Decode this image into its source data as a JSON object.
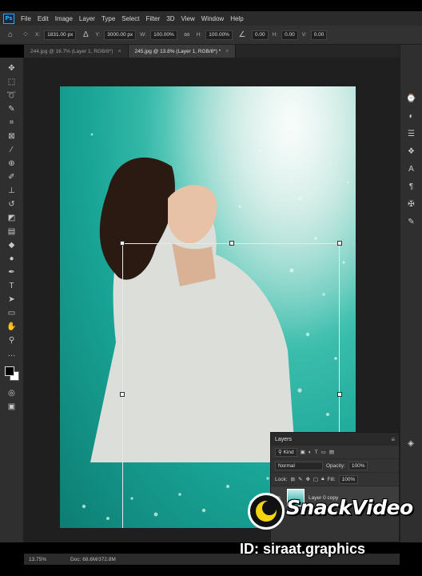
{
  "app": {
    "logo_text": "Ps"
  },
  "menubar": [
    "File",
    "Edit",
    "Image",
    "Layer",
    "Type",
    "Select",
    "Filter",
    "3D",
    "View",
    "Window",
    "Help"
  ],
  "options": {
    "x_label": "X:",
    "x_value": "1831.00 px",
    "y_label": "Y:",
    "y_value": "3000.00 px",
    "w_label": "W:",
    "w_value": "100.00%",
    "h_label": "H:",
    "h_value": "100.00%",
    "angle_value": "0.00",
    "h_skew_label": "H:",
    "h_skew_value": "0.00",
    "v_skew_label": "V:",
    "v_skew_value": "0.00"
  },
  "tabs": [
    {
      "label": "244.jpg @ 16.7% (Layer 1, RGB/8*)",
      "active": false
    },
    {
      "label": "245.jpg @ 13.8% (Layer 1, RGB/8*) *",
      "active": true
    }
  ],
  "layers_panel": {
    "title": "Layers",
    "kind_label": "Kind",
    "blend_mode": "Normal",
    "opacity_label": "Opacity:",
    "opacity_value": "100%",
    "lock_label": "Lock:",
    "fill_label": "Fill:",
    "fill_value": "100%",
    "layer_name": "Layer 0 copy"
  },
  "status": {
    "zoom": "13.75%",
    "doc": "Doc: 68.6M/372.8M"
  },
  "overlay": {
    "brand": "SnackVideo",
    "id_text": "ID: siraat.graphics"
  }
}
